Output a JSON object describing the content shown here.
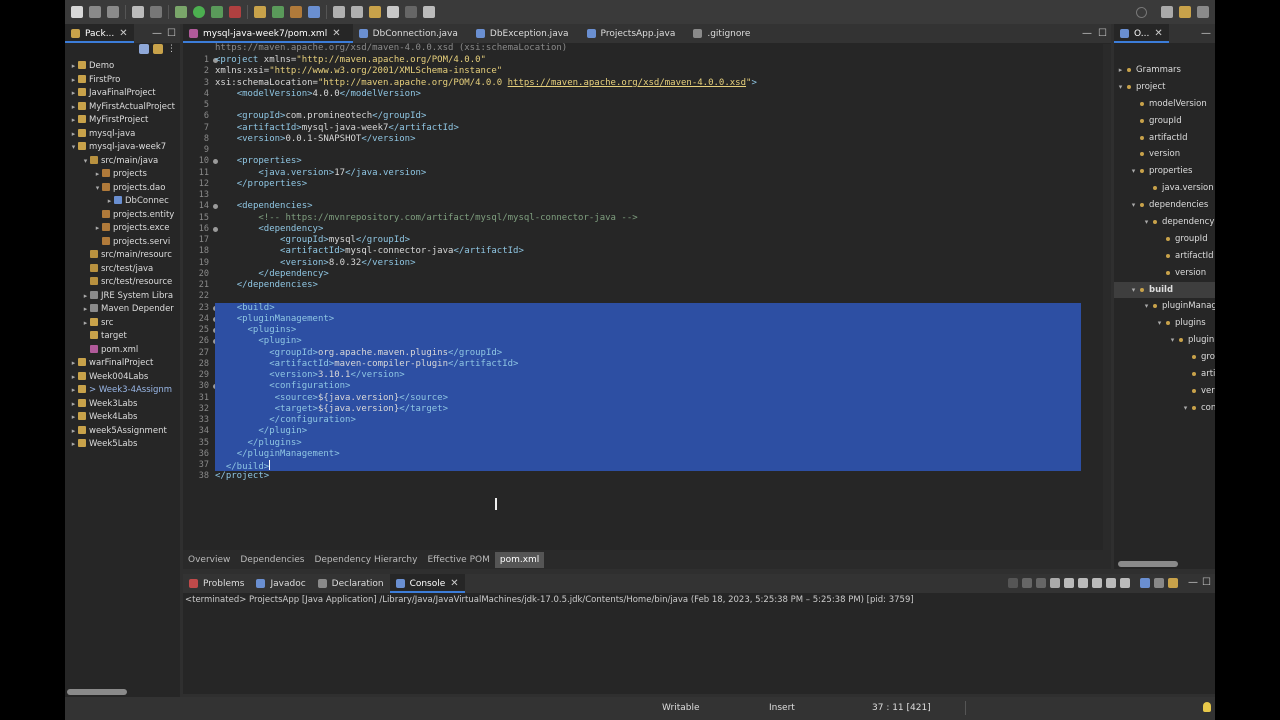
{
  "colors": {
    "accent": "#3c7dd9",
    "selection": "#2d4fa3",
    "tag": "#8fc6e3",
    "attr_value": "#e7d07c",
    "comment": "#7f9f7f"
  },
  "package_explorer": {
    "tab_label": "Pack...",
    "items": [
      {
        "label": "Demo",
        "depth": 0,
        "arrow": "▸",
        "icon": "project-icon",
        "color": "#c8a24a"
      },
      {
        "label": "FirstPro",
        "depth": 0,
        "arrow": "▸",
        "icon": "project-icon",
        "color": "#c8a24a"
      },
      {
        "label": "JavaFinalProject",
        "depth": 0,
        "arrow": "▸",
        "icon": "project-icon",
        "color": "#c8a24a"
      },
      {
        "label": "MyFirstActualProject",
        "depth": 0,
        "arrow": "▸",
        "icon": "project-icon",
        "color": "#c8a24a"
      },
      {
        "label": "MyFirstProject",
        "depth": 0,
        "arrow": "▸",
        "icon": "project-icon",
        "color": "#c8a24a"
      },
      {
        "label": "mysql-java",
        "depth": 0,
        "arrow": "▸",
        "icon": "project-icon",
        "color": "#c8a24a"
      },
      {
        "label": "mysql-java-week7",
        "depth": 0,
        "arrow": "▾",
        "icon": "project-icon",
        "color": "#c8a24a"
      },
      {
        "label": "src/main/java",
        "depth": 1,
        "arrow": "▾",
        "icon": "source-folder-icon",
        "color": "#b8913f"
      },
      {
        "label": "projects",
        "depth": 2,
        "arrow": "▸",
        "icon": "package-icon",
        "color": "#b07a3a"
      },
      {
        "label": "projects.dao",
        "depth": 2,
        "arrow": "▾",
        "icon": "package-icon",
        "color": "#b07a3a"
      },
      {
        "label": "DbConnec",
        "depth": 3,
        "arrow": "▸",
        "icon": "java-file-icon",
        "color": "#6a8fd1"
      },
      {
        "label": "projects.entity",
        "depth": 2,
        "arrow": "",
        "icon": "package-icon",
        "color": "#b07a3a"
      },
      {
        "label": "projects.exce",
        "depth": 2,
        "arrow": "▸",
        "icon": "package-icon",
        "color": "#b07a3a"
      },
      {
        "label": "projects.servi",
        "depth": 2,
        "arrow": "",
        "icon": "package-icon",
        "color": "#b07a3a"
      },
      {
        "label": "src/main/resourc",
        "depth": 1,
        "arrow": "",
        "icon": "source-folder-icon",
        "color": "#b8913f"
      },
      {
        "label": "src/test/java",
        "depth": 1,
        "arrow": "",
        "icon": "source-folder-icon",
        "color": "#b8913f"
      },
      {
        "label": "src/test/resource",
        "depth": 1,
        "arrow": "",
        "icon": "source-folder-icon",
        "color": "#b8913f"
      },
      {
        "label": "JRE System Libra",
        "depth": 1,
        "arrow": "▸",
        "icon": "library-icon",
        "color": "#8a8a8a"
      },
      {
        "label": "Maven Depender",
        "depth": 1,
        "arrow": "▸",
        "icon": "library-icon",
        "color": "#8a8a8a"
      },
      {
        "label": "src",
        "depth": 1,
        "arrow": "▸",
        "icon": "folder-icon",
        "color": "#c8a24a"
      },
      {
        "label": "target",
        "depth": 1,
        "arrow": "",
        "icon": "folder-icon",
        "color": "#c8a24a"
      },
      {
        "label": "pom.xml",
        "depth": 1,
        "arrow": "",
        "icon": "xml-file-icon",
        "color": "#b05a9a"
      },
      {
        "label": "warFinalProject",
        "depth": 0,
        "arrow": "▸",
        "icon": "project-icon",
        "color": "#c8a24a"
      },
      {
        "label": "Week004Labs",
        "depth": 0,
        "arrow": "▸",
        "icon": "project-icon",
        "color": "#c8a24a"
      },
      {
        "label": "> Week3-4Assignm",
        "depth": 0,
        "arrow": "▸",
        "icon": "project-icon",
        "color": "#c8a24a",
        "dim": true
      },
      {
        "label": "Week3Labs",
        "depth": 0,
        "arrow": "▸",
        "icon": "project-icon",
        "color": "#c8a24a"
      },
      {
        "label": "Week4Labs",
        "depth": 0,
        "arrow": "▸",
        "icon": "project-icon",
        "color": "#c8a24a"
      },
      {
        "label": "week5Assignment",
        "depth": 0,
        "arrow": "▸",
        "icon": "project-icon",
        "color": "#c8a24a"
      },
      {
        "label": "Week5Labs",
        "depth": 0,
        "arrow": "▸",
        "icon": "project-icon",
        "color": "#c8a24a"
      }
    ]
  },
  "editor": {
    "tabs": [
      {
        "label": "mysql-java-week7/pom.xml",
        "active": true,
        "closable": true,
        "color": "#b05a9a"
      },
      {
        "label": "DbConnection.java",
        "active": false,
        "closable": false,
        "color": "#6a8fd1"
      },
      {
        "label": "DbException.java",
        "active": false,
        "closable": false,
        "color": "#6a8fd1"
      },
      {
        "label": "ProjectsApp.java",
        "active": false,
        "closable": false,
        "color": "#6a8fd1"
      },
      {
        "label": ".gitignore",
        "active": false,
        "closable": false,
        "color": "#8a8a8a"
      }
    ],
    "top_line": "https://maven.apache.org/xsd/maven-4.0.0.xsd (xsi:schemaLocation)",
    "lines": [
      {
        "n": "1",
        "fold": true,
        "sel": false,
        "segs": [
          [
            "tag",
            "<project "
          ],
          [
            "atn",
            "xmlns="
          ],
          [
            "atv",
            "\"http://maven.apache.org/POM/4.0.0\""
          ]
        ]
      },
      {
        "n": "2",
        "fold": false,
        "sel": false,
        "segs": [
          [
            "atn",
            "xmlns:xsi="
          ],
          [
            "atv",
            "\"http://www.w3.org/2001/XMLSchema-instance\""
          ]
        ]
      },
      {
        "n": "3",
        "fold": false,
        "sel": false,
        "segs": [
          [
            "atn",
            "xsi:schemaLocation="
          ],
          [
            "atv",
            "\"http://maven.apache.org/POM/4.0.0 "
          ],
          [
            "url",
            "https://maven.apache.org/xsd/maven-4.0.0.xsd"
          ],
          [
            "atv",
            "\""
          ],
          [
            "tag",
            ">"
          ]
        ]
      },
      {
        "n": "4",
        "fold": false,
        "sel": false,
        "segs": [
          [
            "txt",
            "    "
          ],
          [
            "tag",
            "<modelVersion>"
          ],
          [
            "txt",
            "4.0.0"
          ],
          [
            "tag",
            "</modelVersion>"
          ]
        ]
      },
      {
        "n": "5",
        "fold": false,
        "sel": false,
        "segs": []
      },
      {
        "n": "6",
        "fold": false,
        "sel": false,
        "segs": [
          [
            "txt",
            "    "
          ],
          [
            "tag",
            "<groupId>"
          ],
          [
            "txt",
            "com.promineotech"
          ],
          [
            "tag",
            "</groupId>"
          ]
        ]
      },
      {
        "n": "7",
        "fold": false,
        "sel": false,
        "segs": [
          [
            "txt",
            "    "
          ],
          [
            "tag",
            "<artifactId>"
          ],
          [
            "txt",
            "mysql-java-week7"
          ],
          [
            "tag",
            "</artifactId>"
          ]
        ]
      },
      {
        "n": "8",
        "fold": false,
        "sel": false,
        "segs": [
          [
            "txt",
            "    "
          ],
          [
            "tag",
            "<version>"
          ],
          [
            "txt",
            "0.0.1-SNAPSHOT"
          ],
          [
            "tag",
            "</version>"
          ]
        ]
      },
      {
        "n": "9",
        "fold": false,
        "sel": false,
        "segs": []
      },
      {
        "n": "10",
        "fold": true,
        "sel": false,
        "segs": [
          [
            "txt",
            "    "
          ],
          [
            "tag",
            "<properties>"
          ]
        ]
      },
      {
        "n": "11",
        "fold": false,
        "sel": false,
        "segs": [
          [
            "txt",
            "        "
          ],
          [
            "tag",
            "<java.version>"
          ],
          [
            "txt",
            "17"
          ],
          [
            "tag",
            "</java.version>"
          ]
        ]
      },
      {
        "n": "12",
        "fold": false,
        "sel": false,
        "segs": [
          [
            "txt",
            "    "
          ],
          [
            "tag",
            "</properties>"
          ]
        ]
      },
      {
        "n": "13",
        "fold": false,
        "sel": false,
        "segs": []
      },
      {
        "n": "14",
        "fold": true,
        "sel": false,
        "segs": [
          [
            "txt",
            "    "
          ],
          [
            "tag",
            "<dependencies>"
          ]
        ]
      },
      {
        "n": "15",
        "fold": false,
        "sel": false,
        "segs": [
          [
            "txt",
            "        "
          ],
          [
            "cmt",
            "<!-- https://mvnrepository.com/artifact/mysql/mysql-connector-java -->"
          ]
        ]
      },
      {
        "n": "16",
        "fold": true,
        "sel": false,
        "segs": [
          [
            "txt",
            "        "
          ],
          [
            "tag",
            "<dependency>"
          ]
        ]
      },
      {
        "n": "17",
        "fold": false,
        "sel": false,
        "segs": [
          [
            "txt",
            "            "
          ],
          [
            "tag",
            "<groupId>"
          ],
          [
            "txt",
            "mysql"
          ],
          [
            "tag",
            "</groupId>"
          ]
        ]
      },
      {
        "n": "18",
        "fold": false,
        "sel": false,
        "segs": [
          [
            "txt",
            "            "
          ],
          [
            "tag",
            "<artifactId>"
          ],
          [
            "txt",
            "mysql-connector-java"
          ],
          [
            "tag",
            "</artifactId>"
          ]
        ]
      },
      {
        "n": "19",
        "fold": false,
        "sel": false,
        "segs": [
          [
            "txt",
            "            "
          ],
          [
            "tag",
            "<version>"
          ],
          [
            "txt",
            "8.0.32"
          ],
          [
            "tag",
            "</version>"
          ]
        ]
      },
      {
        "n": "20",
        "fold": false,
        "sel": false,
        "segs": [
          [
            "txt",
            "        "
          ],
          [
            "tag",
            "</dependency>"
          ]
        ]
      },
      {
        "n": "21",
        "fold": false,
        "sel": false,
        "segs": [
          [
            "txt",
            "    "
          ],
          [
            "tag",
            "</dependencies>"
          ]
        ]
      },
      {
        "n": "22",
        "fold": false,
        "sel": false,
        "segs": []
      },
      {
        "n": "23",
        "fold": true,
        "sel": true,
        "segs": [
          [
            "txt",
            "    "
          ],
          [
            "tag",
            "<build>"
          ]
        ]
      },
      {
        "n": "24",
        "fold": true,
        "sel": true,
        "segs": [
          [
            "txt",
            "    "
          ],
          [
            "tag",
            "<pluginManagement>"
          ]
        ]
      },
      {
        "n": "25",
        "fold": true,
        "sel": true,
        "segs": [
          [
            "txt",
            "      "
          ],
          [
            "tag",
            "<plugins>"
          ]
        ]
      },
      {
        "n": "26",
        "fold": true,
        "sel": true,
        "segs": [
          [
            "txt",
            "        "
          ],
          [
            "tag",
            "<plugin>"
          ]
        ]
      },
      {
        "n": "27",
        "fold": false,
        "sel": true,
        "segs": [
          [
            "txt",
            "          "
          ],
          [
            "tag",
            "<groupId>"
          ],
          [
            "txt",
            "org.apache.maven.plugins"
          ],
          [
            "tag",
            "</groupId>"
          ]
        ]
      },
      {
        "n": "28",
        "fold": false,
        "sel": true,
        "segs": [
          [
            "txt",
            "          "
          ],
          [
            "tag",
            "<artifactId>"
          ],
          [
            "txt",
            "maven-compiler-plugin"
          ],
          [
            "tag",
            "</artifactId>"
          ]
        ]
      },
      {
        "n": "29",
        "fold": false,
        "sel": true,
        "segs": [
          [
            "txt",
            "          "
          ],
          [
            "tag",
            "<version>"
          ],
          [
            "txt",
            "3.10.1"
          ],
          [
            "tag",
            "</version>"
          ]
        ]
      },
      {
        "n": "30",
        "fold": true,
        "sel": true,
        "segs": [
          [
            "txt",
            "          "
          ],
          [
            "tag",
            "<configuration>"
          ]
        ]
      },
      {
        "n": "31",
        "fold": false,
        "sel": true,
        "segs": [
          [
            "txt",
            "           "
          ],
          [
            "tag",
            "<source>"
          ],
          [
            "txt",
            "${java.version}"
          ],
          [
            "tag",
            "</source>"
          ]
        ]
      },
      {
        "n": "32",
        "fold": false,
        "sel": true,
        "segs": [
          [
            "txt",
            "           "
          ],
          [
            "tag",
            "<target>"
          ],
          [
            "txt",
            "${java.version}"
          ],
          [
            "tag",
            "</target>"
          ]
        ]
      },
      {
        "n": "33",
        "fold": false,
        "sel": true,
        "segs": [
          [
            "txt",
            "          "
          ],
          [
            "tag",
            "</configuration>"
          ]
        ]
      },
      {
        "n": "34",
        "fold": false,
        "sel": true,
        "segs": [
          [
            "txt",
            "        "
          ],
          [
            "tag",
            "</plugin>"
          ]
        ]
      },
      {
        "n": "35",
        "fold": false,
        "sel": true,
        "segs": [
          [
            "txt",
            "      "
          ],
          [
            "tag",
            "</plugins>"
          ]
        ]
      },
      {
        "n": "36",
        "fold": false,
        "sel": true,
        "segs": [
          [
            "txt",
            "    "
          ],
          [
            "tag",
            "</pluginManagement>"
          ]
        ]
      },
      {
        "n": "37",
        "fold": false,
        "sel": true,
        "segs": [
          [
            "txt",
            "  "
          ],
          [
            "tag",
            "</build>"
          ]
        ]
      },
      {
        "n": "38",
        "fold": false,
        "sel": false,
        "segs": [
          [
            "tag",
            "</project>"
          ]
        ]
      }
    ],
    "bottom_tabs": [
      {
        "label": "Overview",
        "active": false
      },
      {
        "label": "Dependencies",
        "active": false
      },
      {
        "label": "Dependency Hierarchy",
        "active": false
      },
      {
        "label": "Effective POM",
        "active": false
      },
      {
        "label": "pom.xml",
        "active": true
      }
    ]
  },
  "outline": {
    "tab_label": "O...",
    "items": [
      {
        "label": "Grammars",
        "depth": 0,
        "arrow": "▸",
        "bold": false
      },
      {
        "label": "project",
        "depth": 0,
        "arrow": "▾",
        "bold": false
      },
      {
        "label": "modelVersion",
        "depth": 1,
        "arrow": "",
        "bold": false
      },
      {
        "label": "groupId",
        "depth": 1,
        "arrow": "",
        "bold": false
      },
      {
        "label": "artifactId",
        "depth": 1,
        "arrow": "",
        "bold": false
      },
      {
        "label": "version",
        "depth": 1,
        "arrow": "",
        "bold": false
      },
      {
        "label": "properties",
        "depth": 1,
        "arrow": "▾",
        "bold": false
      },
      {
        "label": "java.version",
        "depth": 2,
        "arrow": "",
        "bold": false
      },
      {
        "label": "dependencies",
        "depth": 1,
        "arrow": "▾",
        "bold": false
      },
      {
        "label": "dependency",
        "depth": 2,
        "arrow": "▾",
        "bold": false
      },
      {
        "label": "groupId",
        "depth": 3,
        "arrow": "",
        "bold": false
      },
      {
        "label": "artifactId",
        "depth": 3,
        "arrow": "",
        "bold": false
      },
      {
        "label": "version",
        "depth": 3,
        "arrow": "",
        "bold": false
      },
      {
        "label": "build",
        "depth": 1,
        "arrow": "▾",
        "bold": true
      },
      {
        "label": "pluginManagement",
        "depth": 2,
        "arrow": "▾",
        "bold": false
      },
      {
        "label": "plugins",
        "depth": 3,
        "arrow": "▾",
        "bold": false
      },
      {
        "label": "plugin",
        "depth": 4,
        "arrow": "▾",
        "bold": false
      },
      {
        "label": "groupId",
        "depth": 5,
        "arrow": "",
        "bold": false
      },
      {
        "label": "artifactId",
        "depth": 5,
        "arrow": "",
        "bold": false
      },
      {
        "label": "version",
        "depth": 5,
        "arrow": "",
        "bold": false
      },
      {
        "label": "configuration",
        "depth": 5,
        "arrow": "▾",
        "bold": false
      }
    ]
  },
  "console": {
    "tabs": [
      {
        "label": "Problems",
        "active": false,
        "closable": false,
        "color": "#c04a4a"
      },
      {
        "label": "Javadoc",
        "active": false,
        "closable": false,
        "color": "#6a8fd1"
      },
      {
        "label": "Declaration",
        "active": false,
        "closable": false,
        "color": "#8a8a8a"
      },
      {
        "label": "Console",
        "active": true,
        "closable": true,
        "color": "#6a8fd1"
      }
    ],
    "output": "<terminated> ProjectsApp [Java Application] /Library/Java/JavaVirtualMachines/jdk-17.0.5.jdk/Contents/Home/bin/java  (Feb 18, 2023, 5:25:38 PM – 5:25:38 PM) [pid: 3759]"
  },
  "status": {
    "writable": "Writable",
    "insert": "Insert",
    "position": "37 : 11 [421]"
  }
}
